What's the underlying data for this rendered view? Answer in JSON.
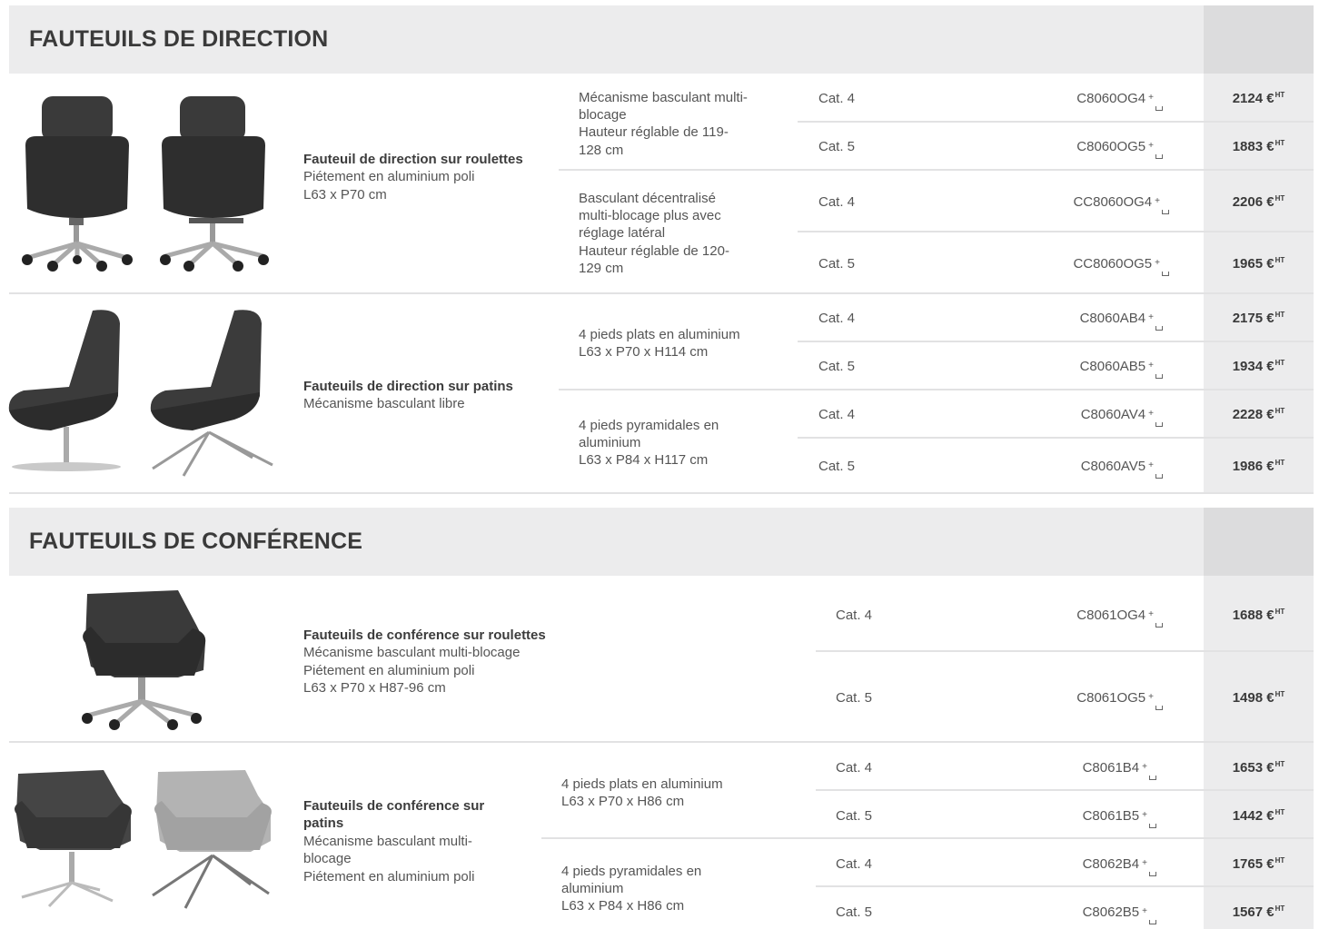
{
  "section1": {
    "title": "FAUTEUILS DE DIRECTION"
  },
  "section2": {
    "title": "FAUTEUILS DE CONFÉRENCE"
  },
  "currency": "€",
  "tax_label": "HT",
  "product1": {
    "title": "Fauteuil de direction sur roulettes",
    "lines": [
      "Piétement en aluminium poli",
      "L63 x P70 cm"
    ],
    "options": [
      {
        "lines": [
          "Mécanisme basculant multi-",
          "blocage",
          "Hauteur réglable de 119-",
          "128 cm"
        ]
      },
      {
        "lines": [
          "Basculant décentralisé",
          "multi-blocage plus avec",
          "réglage latéral",
          "Hauteur réglable de 120-",
          "129 cm"
        ]
      }
    ],
    "rows": [
      {
        "cat": "Cat. 4",
        "ref": "C8060OG4",
        "price": "2124 €"
      },
      {
        "cat": "Cat. 5",
        "ref": "C8060OG5",
        "price": "1883 €"
      },
      {
        "cat": "Cat. 4",
        "ref": "CC8060OG4",
        "price": "2206 €"
      },
      {
        "cat": "Cat. 5",
        "ref": "CC8060OG5",
        "price": "1965 €"
      }
    ]
  },
  "product2": {
    "title": "Fauteuils de direction sur patins",
    "lines": [
      "Mécanisme basculant libre"
    ],
    "options": [
      {
        "lines": [
          "4 pieds plats en aluminium",
          "L63 x P70 x H114 cm"
        ]
      },
      {
        "lines": [
          "4 pieds pyramidales en",
          "aluminium",
          "L63 x P84 x H117 cm"
        ]
      }
    ],
    "rows": [
      {
        "cat": "Cat. 4",
        "ref": "C8060AB4",
        "price": "2175 €"
      },
      {
        "cat": "Cat. 5",
        "ref": "C8060AB5",
        "price": "1934 €"
      },
      {
        "cat": "Cat. 4",
        "ref": "C8060AV4",
        "price": "2228 €"
      },
      {
        "cat": "Cat. 5",
        "ref": "C8060AV5",
        "price": "1986 €"
      }
    ]
  },
  "product3": {
    "title": "Fauteuils de conférence sur roulettes",
    "lines": [
      "Mécanisme basculant multi-blocage",
      "Piétement en aluminium poli",
      "L63 x P70 x H87-96 cm"
    ],
    "rows": [
      {
        "cat": "Cat. 4",
        "ref": "C8061OG4",
        "price": "1688 €"
      },
      {
        "cat": "Cat. 5",
        "ref": "C8061OG5",
        "price": "1498 €"
      }
    ]
  },
  "product4": {
    "title_lines": [
      "Fauteuils de conférence sur",
      "patins"
    ],
    "lines": [
      "Mécanisme basculant multi-",
      "blocage",
      "Piétement en aluminium poli"
    ],
    "options": [
      {
        "lines": [
          "4 pieds plats en aluminium",
          "L63 x P70 x H86 cm"
        ]
      },
      {
        "lines": [
          "4 pieds pyramidales en",
          "aluminium",
          "L63 x P84 x H86 cm"
        ]
      }
    ],
    "rows": [
      {
        "cat": "Cat. 4",
        "ref": "C8061B4",
        "price": "1653 €"
      },
      {
        "cat": "Cat. 5",
        "ref": "C8061B5",
        "price": "1442 €"
      },
      {
        "cat": "Cat. 4",
        "ref": "C8062B4",
        "price": "1765 €"
      },
      {
        "cat": "Cat. 5",
        "ref": "C8062B5",
        "price": "1567 €"
      }
    ]
  }
}
